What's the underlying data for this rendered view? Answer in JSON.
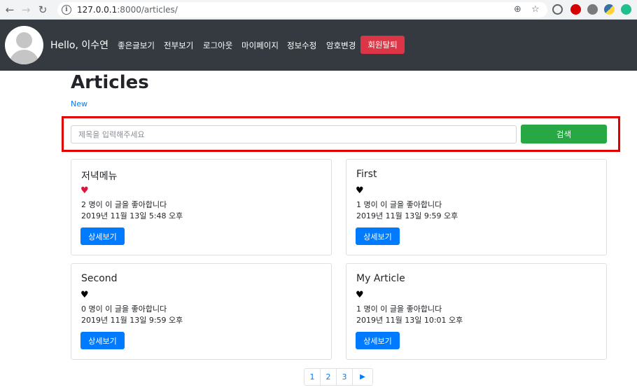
{
  "browser": {
    "url_host": "127.0.0.1",
    "url_path": ":8000/articles/"
  },
  "navbar": {
    "greeting": "Hello, 이수연",
    "links": [
      "좋은글보기",
      "전부보기",
      "로그아웃",
      "마이페이지",
      "정보수정",
      "암호변경"
    ],
    "withdraw_label": "회원탈퇴"
  },
  "page": {
    "title": "Articles",
    "new_link": "New"
  },
  "search": {
    "placeholder": "제목을 입력해주세요",
    "button_label": "검색"
  },
  "articles": [
    {
      "title": "저녁메뉴",
      "heart": "♥",
      "heart_color": "#dc143c",
      "likes": "2 명이 이 글을 좋아합니다",
      "date": "2019년 11월 13일 5:48 오후",
      "button": "상세보기"
    },
    {
      "title": "First",
      "heart": "♥",
      "heart_color": "#000000",
      "likes": "1 명이 이 글을 좋아합니다",
      "date": "2019년 11월 13일 9:59 오후",
      "button": "상세보기"
    },
    {
      "title": "Second",
      "heart": "♥",
      "heart_color": "#000000",
      "likes": "0 명이 이 글을 좋아합니다",
      "date": "2019년 11월 13일 9:59 오후",
      "button": "상세보기"
    },
    {
      "title": "My Article",
      "heart": "♥",
      "heart_color": "#000000",
      "likes": "1 명이 이 글을 좋아합니다",
      "date": "2019년 11월 13일 10:01 오후",
      "button": "상세보기"
    }
  ],
  "pagination": [
    "1",
    "2",
    "3",
    "▶"
  ],
  "colors": {
    "navbar_bg": "#343a40",
    "danger": "#dc3545",
    "success": "#28a745",
    "primary": "#007bff",
    "highlight_border": "#e00000"
  }
}
